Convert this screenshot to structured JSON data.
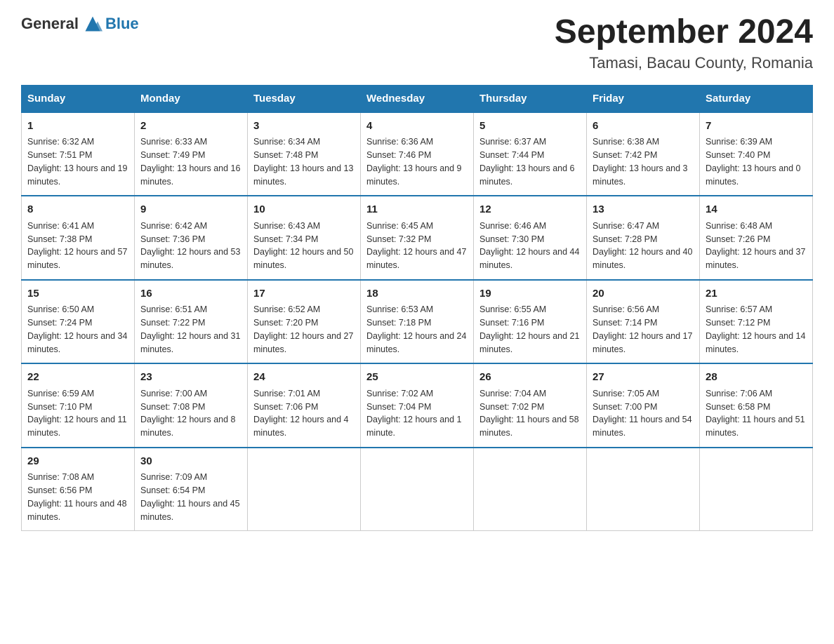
{
  "header": {
    "logo_general": "General",
    "logo_blue": "Blue",
    "month_title": "September 2024",
    "location": "Tamasi, Bacau County, Romania"
  },
  "days_of_week": [
    "Sunday",
    "Monday",
    "Tuesday",
    "Wednesday",
    "Thursday",
    "Friday",
    "Saturday"
  ],
  "weeks": [
    [
      {
        "day": "1",
        "sunrise": "6:32 AM",
        "sunset": "7:51 PM",
        "daylight": "13 hours and 19 minutes."
      },
      {
        "day": "2",
        "sunrise": "6:33 AM",
        "sunset": "7:49 PM",
        "daylight": "13 hours and 16 minutes."
      },
      {
        "day": "3",
        "sunrise": "6:34 AM",
        "sunset": "7:48 PM",
        "daylight": "13 hours and 13 minutes."
      },
      {
        "day": "4",
        "sunrise": "6:36 AM",
        "sunset": "7:46 PM",
        "daylight": "13 hours and 9 minutes."
      },
      {
        "day": "5",
        "sunrise": "6:37 AM",
        "sunset": "7:44 PM",
        "daylight": "13 hours and 6 minutes."
      },
      {
        "day": "6",
        "sunrise": "6:38 AM",
        "sunset": "7:42 PM",
        "daylight": "13 hours and 3 minutes."
      },
      {
        "day": "7",
        "sunrise": "6:39 AM",
        "sunset": "7:40 PM",
        "daylight": "13 hours and 0 minutes."
      }
    ],
    [
      {
        "day": "8",
        "sunrise": "6:41 AM",
        "sunset": "7:38 PM",
        "daylight": "12 hours and 57 minutes."
      },
      {
        "day": "9",
        "sunrise": "6:42 AM",
        "sunset": "7:36 PM",
        "daylight": "12 hours and 53 minutes."
      },
      {
        "day": "10",
        "sunrise": "6:43 AM",
        "sunset": "7:34 PM",
        "daylight": "12 hours and 50 minutes."
      },
      {
        "day": "11",
        "sunrise": "6:45 AM",
        "sunset": "7:32 PM",
        "daylight": "12 hours and 47 minutes."
      },
      {
        "day": "12",
        "sunrise": "6:46 AM",
        "sunset": "7:30 PM",
        "daylight": "12 hours and 44 minutes."
      },
      {
        "day": "13",
        "sunrise": "6:47 AM",
        "sunset": "7:28 PM",
        "daylight": "12 hours and 40 minutes."
      },
      {
        "day": "14",
        "sunrise": "6:48 AM",
        "sunset": "7:26 PM",
        "daylight": "12 hours and 37 minutes."
      }
    ],
    [
      {
        "day": "15",
        "sunrise": "6:50 AM",
        "sunset": "7:24 PM",
        "daylight": "12 hours and 34 minutes."
      },
      {
        "day": "16",
        "sunrise": "6:51 AM",
        "sunset": "7:22 PM",
        "daylight": "12 hours and 31 minutes."
      },
      {
        "day": "17",
        "sunrise": "6:52 AM",
        "sunset": "7:20 PM",
        "daylight": "12 hours and 27 minutes."
      },
      {
        "day": "18",
        "sunrise": "6:53 AM",
        "sunset": "7:18 PM",
        "daylight": "12 hours and 24 minutes."
      },
      {
        "day": "19",
        "sunrise": "6:55 AM",
        "sunset": "7:16 PM",
        "daylight": "12 hours and 21 minutes."
      },
      {
        "day": "20",
        "sunrise": "6:56 AM",
        "sunset": "7:14 PM",
        "daylight": "12 hours and 17 minutes."
      },
      {
        "day": "21",
        "sunrise": "6:57 AM",
        "sunset": "7:12 PM",
        "daylight": "12 hours and 14 minutes."
      }
    ],
    [
      {
        "day": "22",
        "sunrise": "6:59 AM",
        "sunset": "7:10 PM",
        "daylight": "12 hours and 11 minutes."
      },
      {
        "day": "23",
        "sunrise": "7:00 AM",
        "sunset": "7:08 PM",
        "daylight": "12 hours and 8 minutes."
      },
      {
        "day": "24",
        "sunrise": "7:01 AM",
        "sunset": "7:06 PM",
        "daylight": "12 hours and 4 minutes."
      },
      {
        "day": "25",
        "sunrise": "7:02 AM",
        "sunset": "7:04 PM",
        "daylight": "12 hours and 1 minute."
      },
      {
        "day": "26",
        "sunrise": "7:04 AM",
        "sunset": "7:02 PM",
        "daylight": "11 hours and 58 minutes."
      },
      {
        "day": "27",
        "sunrise": "7:05 AM",
        "sunset": "7:00 PM",
        "daylight": "11 hours and 54 minutes."
      },
      {
        "day": "28",
        "sunrise": "7:06 AM",
        "sunset": "6:58 PM",
        "daylight": "11 hours and 51 minutes."
      }
    ],
    [
      {
        "day": "29",
        "sunrise": "7:08 AM",
        "sunset": "6:56 PM",
        "daylight": "11 hours and 48 minutes."
      },
      {
        "day": "30",
        "sunrise": "7:09 AM",
        "sunset": "6:54 PM",
        "daylight": "11 hours and 45 minutes."
      },
      null,
      null,
      null,
      null,
      null
    ]
  ],
  "labels": {
    "sunrise": "Sunrise:",
    "sunset": "Sunset:",
    "daylight": "Daylight:"
  }
}
